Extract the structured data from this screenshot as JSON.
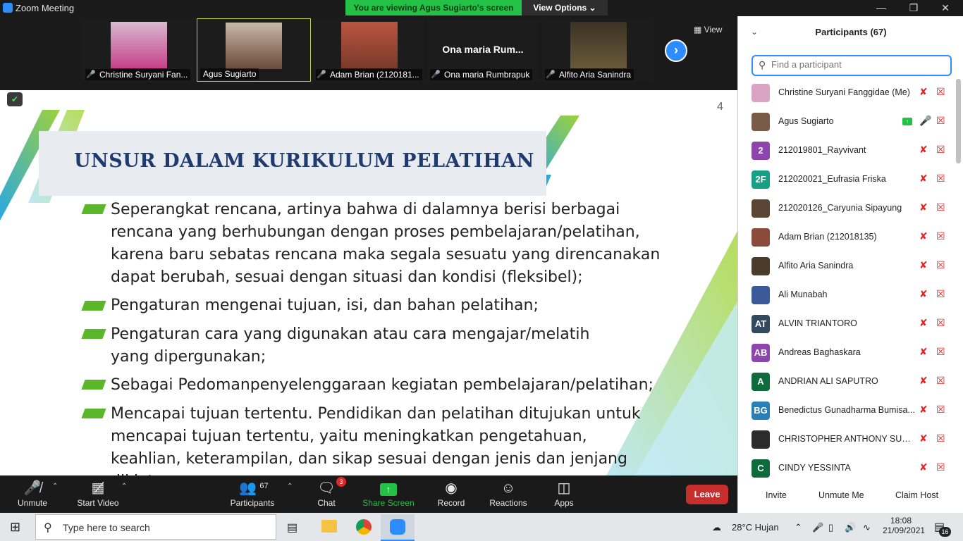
{
  "window": {
    "title": "Zoom Meeting",
    "banner": "You are viewing Agus Sugiarto's screen",
    "view_options": "View Options ⌄"
  },
  "thumbnails": [
    {
      "name": "Christine Suryani Fan...",
      "muted": true
    },
    {
      "name": "Agus Sugiarto",
      "muted": false,
      "active": true
    },
    {
      "name": "Adam Brian (2120181...",
      "muted": true
    },
    {
      "name": "Ona maria Rumbrapuk",
      "display": "Ona maria Rum...",
      "muted": true
    },
    {
      "name": "Alfito Aria Sanindra",
      "muted": true
    }
  ],
  "view_label": "View",
  "slide": {
    "number": "4",
    "title": "UNSUR DALAM KURIKULUM PELATIHAN",
    "bullets": [
      "Seperangkat rencana, artinya bahwa di dalamnya berisi berbagai rencana yang berhubungan dengan proses pembelajaran/pelatihan, karena baru sebatas rencana maka segala sesuatu yang direncanakan dapat berubah, sesuai dengan situasi dan kondisi (fleksibel);",
      "Pengaturan mengenai tujuan, isi, dan bahan pelatihan;",
      "Pengaturan cara yang digunakan atau cara mengajar/melatih yang dipergunakan;",
      "Sebagai Pedomanpenyelenggaraan kegiatan pembelajaran/pelatihan;",
      "Mencapai tujuan tertentu. Pendidikan dan pelatihan ditujukan  untuk mencapai tujuan tertentu, yaitu meningkatkan pengetahuan, keahlian, keterampilan, dan sikap sesuai dengan  jenis dan jenjang diklat."
    ],
    "colors": {
      "title": "#1f3a6e",
      "bullet": "#5ab62a",
      "band": "#e8ebf0"
    }
  },
  "toolbar": {
    "unmute": "Unmute",
    "start_video": "Start Video",
    "participants": "Participants",
    "participants_count": "67",
    "chat": "Chat",
    "chat_badge": "3",
    "share_screen": "Share Screen",
    "record": "Record",
    "reactions": "Reactions",
    "apps": "Apps",
    "leave": "Leave"
  },
  "panel": {
    "title": "Participants (67)",
    "search_placeholder": "Find a participant",
    "participants": [
      {
        "name": "Christine Suryani Fanggidae (Me)",
        "initials": "",
        "color": "#d9a4c4"
      },
      {
        "name": "Agus Sugiarto",
        "initials": "",
        "color": "#7a5b4a",
        "sharing": true
      },
      {
        "name": "212019801_Rayvivant",
        "initials": "2",
        "color": "#8e44ad"
      },
      {
        "name": "212020021_Eufrasia Friska",
        "initials": "2F",
        "color": "#16a085"
      },
      {
        "name": "212020126_Caryunia Sipayung",
        "initials": "",
        "color": "#5b4636"
      },
      {
        "name": "Adam Brian (212018135)",
        "initials": "",
        "color": "#8a4b3a"
      },
      {
        "name": "Alfito Aria Sanindra",
        "initials": "",
        "color": "#4a3b2a"
      },
      {
        "name": "Ali Munabah",
        "initials": "",
        "color": "#3b5998"
      },
      {
        "name": "ALVIN TRIANTORO",
        "initials": "AT",
        "color": "#34495e"
      },
      {
        "name": "Andreas Baghaskara",
        "initials": "AB",
        "color": "#8e44ad"
      },
      {
        "name": "ANDRIAN ALI SAPUTRO",
        "initials": "A",
        "color": "#0e6b3c"
      },
      {
        "name": "Benedictus Gunadharma Bumisa...",
        "initials": "BG",
        "color": "#2980b9"
      },
      {
        "name": "CHRISTOPHER ANTHONY SURY...",
        "initials": "",
        "color": "#2c2c2c"
      },
      {
        "name": "CINDY YESSINTA",
        "initials": "C",
        "color": "#0e6b3c"
      }
    ],
    "invite": "Invite",
    "unmute_me": "Unmute Me",
    "claim_host": "Claim Host"
  },
  "taskbar": {
    "search_text": "Type here to search",
    "weather": "28°C  Hujan",
    "time": "18:08",
    "date": "21/09/2021",
    "notif": "16"
  }
}
